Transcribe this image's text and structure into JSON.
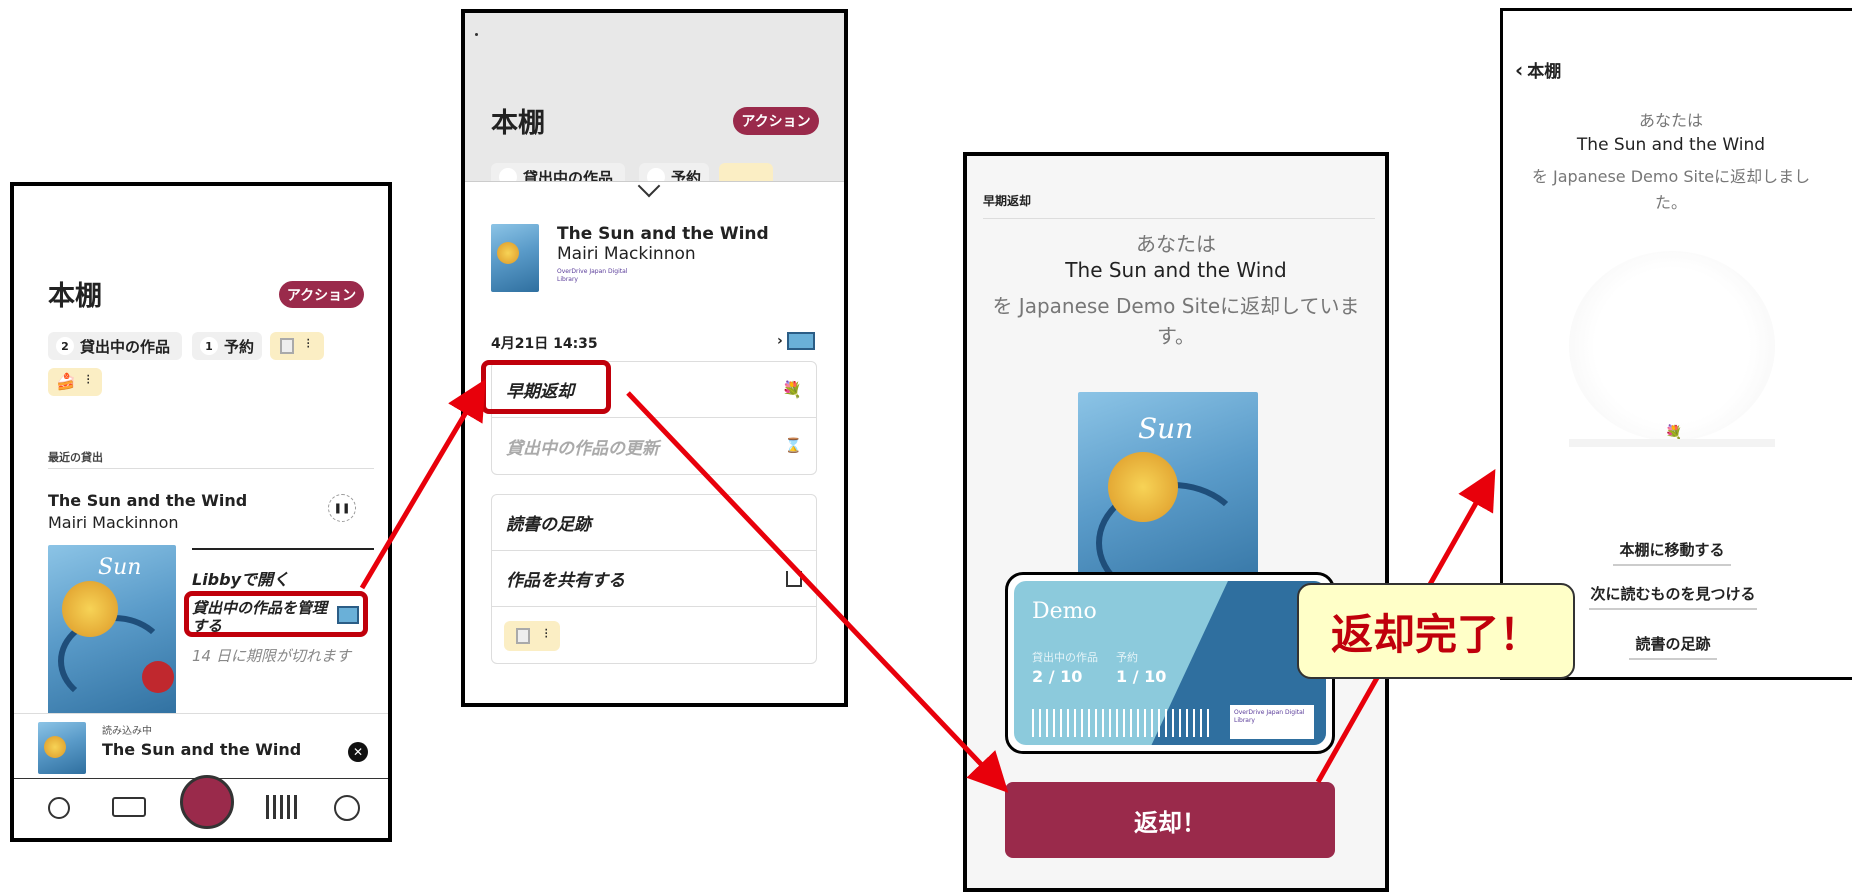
{
  "panel1": {
    "title": "本棚",
    "action_label": "アクション",
    "loans_pill": {
      "count": "2",
      "label": "貸出中の作品"
    },
    "holds_pill": {
      "count": "1",
      "label": "予約"
    },
    "section_label": "最近の貸出",
    "book_title": "The Sun and the Wind",
    "book_author": "Mairi Mackinnon",
    "open_in_libby": "Libbyで開く",
    "manage_loan": "貸出中の作品を管理する",
    "expires": "14 日に期限が切れます",
    "mini_player": {
      "status": "読み込み中",
      "title": "The Sun and the Wind"
    }
  },
  "panel2": {
    "title": "本棚",
    "action_label": "アクション",
    "book_title": "The Sun and the Wind",
    "book_author": "Mairi Mackinnon",
    "library_name": "OverDrive Japan Digital Library",
    "due_date": "4月21日 14:35",
    "return_early": "早期返却",
    "renew_loan": "貸出中の作品の更新",
    "reading_journey": "読書の足跡",
    "share": "作品を共有する",
    "pill_loans_partial": "貸出中の作品",
    "pill_holds_partial": "予約"
  },
  "panel3": {
    "header": "早期返却",
    "line1": "あなたは",
    "line2": "The Sun and the Wind",
    "line3": "を Japanese Demo Siteに返却していま",
    "line4": "す。",
    "card": {
      "name": "Demo",
      "loans_label": "貸出中の作品",
      "holds_label": "予約",
      "loans_value": "2 / 10",
      "holds_value": "1 / 10",
      "library": "OverDrive Japan Digital Library"
    },
    "return_button": "返却！"
  },
  "panel4": {
    "back_label": "本棚",
    "line1": "あなたは",
    "line2": "The Sun and the Wind",
    "line3": "を Japanese Demo Siteに返却しまし",
    "line4": "た。",
    "go_to_shelf": "本棚に移動する",
    "find_next": "次に読むものを見つける",
    "reading_journey": "読書の足跡"
  },
  "callout": "返却完了！",
  "colors": {
    "brand": "#9a2a4b",
    "arrow": "#e8000b",
    "callout_bg": "#ffffc8",
    "callout_text": "#c0000b"
  }
}
